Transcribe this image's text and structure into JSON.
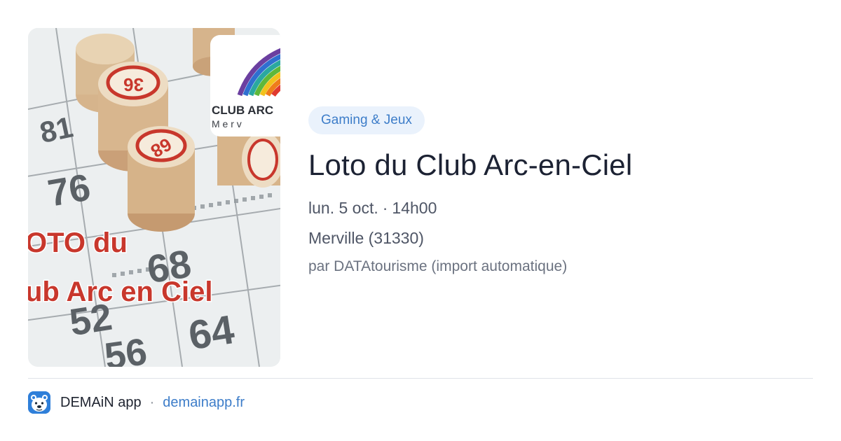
{
  "event": {
    "category": "Gaming & Jeux",
    "title": "Loto du Club Arc-en-Ciel",
    "date": "lun. 5 oct.",
    "time": "14h00",
    "meta_separator": "·",
    "location": "Merville (31330)",
    "source": "par DATAtourisme (import automatique)"
  },
  "image": {
    "overlay_line1": "OTO du",
    "overlay_line2": "ub Arc en Ciel",
    "logo_text": "CLUB ARC",
    "logo_subtext": "M e r v",
    "grid_numbers": [
      "81",
      "76",
      "68",
      "52",
      "64",
      "56"
    ],
    "token_numbers": [
      "36",
      "68"
    ]
  },
  "footer": {
    "app_name": "DEMAiN app",
    "separator": "·",
    "link_text": "demainapp.fr",
    "icon": "bear-face-icon"
  },
  "colors": {
    "chip_bg": "#eaf2fc",
    "chip_text": "#3d7dc9",
    "title": "#1c2233",
    "meta": "#4f5666",
    "source": "#6b7280",
    "link": "#3d7dc9",
    "app_logo_bg": "#2f7fd9",
    "overlay_red": "#c8372c"
  }
}
